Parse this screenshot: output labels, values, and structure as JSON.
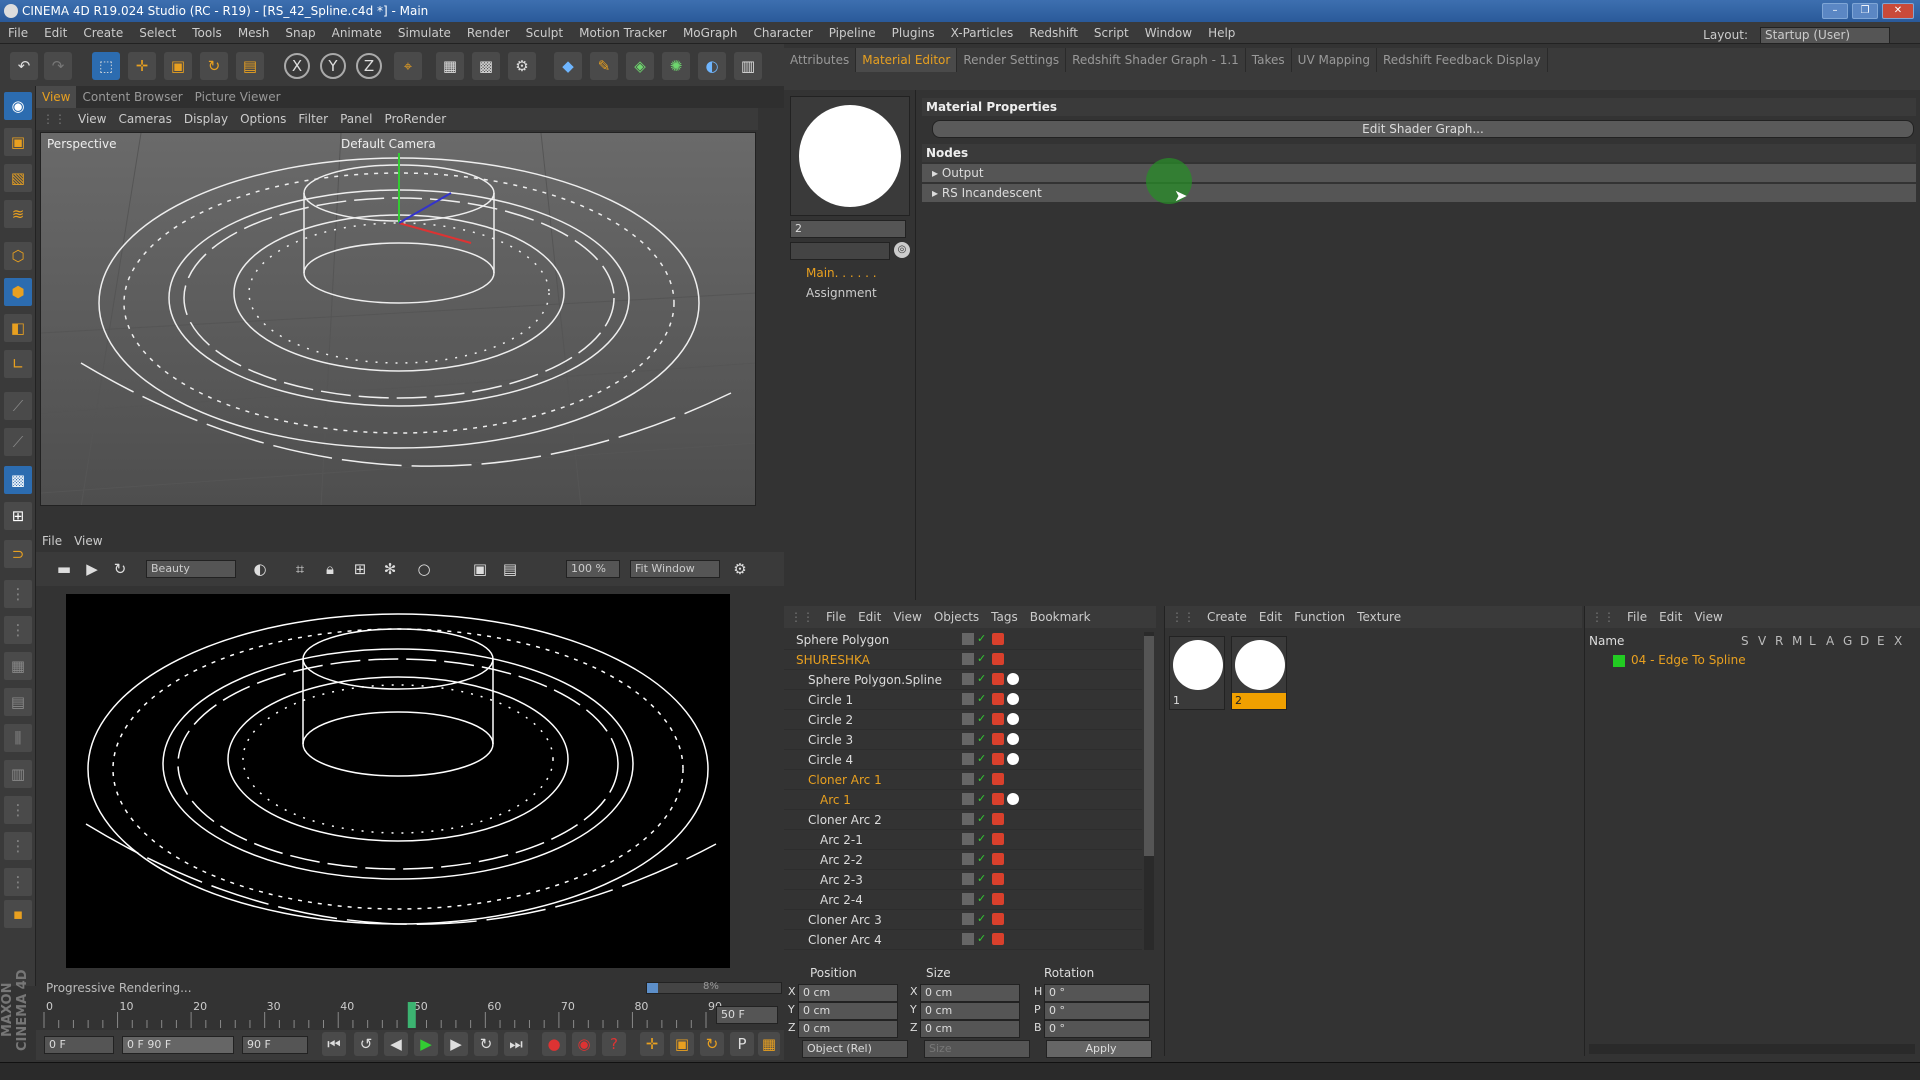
{
  "window": {
    "title": "CINEMA 4D R19.024 Studio (RC - R19) - [RS_42_Spline.c4d *] - Main"
  },
  "menu": [
    "File",
    "Edit",
    "Create",
    "Select",
    "Tools",
    "Mesh",
    "Snap",
    "Animate",
    "Simulate",
    "Render",
    "Sculpt",
    "Motion Tracker",
    "MoGraph",
    "Character",
    "Pipeline",
    "Plugins",
    "X-Particles",
    "Redshift",
    "Script",
    "Window",
    "Help"
  ],
  "layout": {
    "label": "Layout:",
    "value": "Startup (User)"
  },
  "toolbar": {
    "x": "X",
    "y": "Y",
    "z": "Z"
  },
  "view_tabs": [
    "View",
    "Content Browser",
    "Picture Viewer"
  ],
  "viewport": {
    "menu": [
      "View",
      "Cameras",
      "Display",
      "Options",
      "Filter",
      "Panel",
      "ProRender"
    ],
    "label": "Perspective",
    "camera": "Default Camera"
  },
  "picture_viewer": {
    "menu": [
      "File",
      "View"
    ],
    "mode": "Beauty",
    "zoom": "100 %",
    "fit": "Fit Window"
  },
  "progress": {
    "label": "Progressive Rendering...",
    "value": "8%",
    "fraction": 0.08
  },
  "timeline": {
    "ticks": [
      "0",
      "10",
      "20",
      "30",
      "40",
      "50",
      "60",
      "70",
      "80",
      "90"
    ],
    "current_frame": 50,
    "end_label": "50 F"
  },
  "transport": {
    "start": "0 F",
    "range": "0 F   90 F",
    "end": "90 F"
  },
  "attr_tabs": [
    "Attributes",
    "Material Editor",
    "Render Settings",
    "Redshift Shader Graph - 1.1",
    "Takes",
    "UV Mapping",
    "Redshift Feedback Display"
  ],
  "material": {
    "name": "2",
    "nav": [
      "Main. . . . . .",
      "Assignment"
    ],
    "properties_title": "Material Properties",
    "edit_button": "Edit Shader Graph...",
    "nodes_title": "Nodes",
    "nodes": [
      "Output",
      "RS Incandescent"
    ]
  },
  "object_manager": {
    "menu": [
      "File",
      "Edit",
      "View",
      "Objects",
      "Tags",
      "Bookmark"
    ],
    "rows": [
      {
        "name": "Sphere Polygon",
        "indent": 0,
        "orange": false
      },
      {
        "name": "SHURESHKA",
        "indent": 0,
        "orange": true
      },
      {
        "name": "Sphere Polygon.Spline",
        "indent": 1,
        "orange": false
      },
      {
        "name": "Circle 1",
        "indent": 1,
        "orange": false
      },
      {
        "name": "Circle 2",
        "indent": 1,
        "orange": false
      },
      {
        "name": "Circle 3",
        "indent": 1,
        "orange": false
      },
      {
        "name": "Circle 4",
        "indent": 1,
        "orange": false
      },
      {
        "name": "Cloner Arc 1",
        "indent": 1,
        "orange": true
      },
      {
        "name": "Arc 1",
        "indent": 2,
        "orange": true
      },
      {
        "name": "Cloner Arc 2",
        "indent": 1,
        "orange": false
      },
      {
        "name": "Arc 2-1",
        "indent": 2,
        "orange": false
      },
      {
        "name": "Arc 2-2",
        "indent": 2,
        "orange": false
      },
      {
        "name": "Arc 2-3",
        "indent": 2,
        "orange": false
      },
      {
        "name": "Arc 2-4",
        "indent": 2,
        "orange": false
      },
      {
        "name": "Cloner Arc 3",
        "indent": 1,
        "orange": false
      },
      {
        "name": "Cloner Arc 4",
        "indent": 1,
        "orange": false
      }
    ]
  },
  "coords": {
    "headers": [
      "Position",
      "Size",
      "Rotation"
    ],
    "rows": [
      {
        "a": "X",
        "pos": "0 cm",
        "b": "X",
        "size": "0 cm",
        "c": "H",
        "rot": "0 °"
      },
      {
        "a": "Y",
        "pos": "0 cm",
        "b": "Y",
        "size": "0 cm",
        "c": "P",
        "rot": "0 °"
      },
      {
        "a": "Z",
        "pos": "0 cm",
        "b": "Z",
        "size": "0 cm",
        "c": "B",
        "rot": "0 °"
      }
    ],
    "mode": "Object (Rel)",
    "size_mode": "Size",
    "apply": "Apply"
  },
  "material_manager": {
    "menu": [
      "Create",
      "Edit",
      "Function",
      "Texture"
    ],
    "materials": [
      "1",
      "2"
    ]
  },
  "layer_manager": {
    "menu": [
      "File",
      "Edit",
      "View"
    ],
    "name_header": "Name",
    "cols": [
      "S",
      "V",
      "R",
      "M",
      "L",
      "A",
      "G",
      "D",
      "E",
      "X"
    ],
    "layer": "04 - Edge To Spline"
  }
}
